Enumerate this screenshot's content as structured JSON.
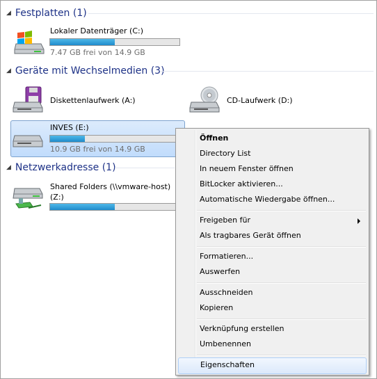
{
  "groups": [
    {
      "title": "Festplatten (1)"
    },
    {
      "title": "Geräte mit Wechselmedien (3)"
    },
    {
      "title": "Netzwerkadresse (1)"
    }
  ],
  "drives": {
    "local_c": {
      "name": "Lokaler Datenträger (C:)",
      "free": "7.47 GB frei von 14.9 GB",
      "used_fraction": 0.5,
      "icon": "hard-drive-windows-icon"
    },
    "floppy_a": {
      "name": "Diskettenlaufwerk (A:)",
      "icon": "floppy-drive-icon"
    },
    "cd_d": {
      "name": "CD-Laufwerk (D:)",
      "icon": "cd-drive-icon"
    },
    "usb_e": {
      "name": "INVES (E:)",
      "free": "10.9 GB frei von 14.9 GB",
      "used_fraction": 0.27,
      "icon": "removable-drive-icon"
    },
    "network_z": {
      "name_line1": "Shared Folders (\\\\vmware-host)",
      "name_line2": "(Z:)",
      "used_fraction": 0.5,
      "icon": "network-drive-icon"
    }
  },
  "context_menu": {
    "items": [
      {
        "label": "Öffnen",
        "bold": true
      },
      {
        "label": "Directory List"
      },
      {
        "label": "In neuem Fenster öffnen"
      },
      {
        "label": "BitLocker aktivieren..."
      },
      {
        "label": "Automatische Wiedergabe öffnen..."
      },
      {
        "label": "Freigeben für",
        "submenu": true
      },
      {
        "label": "Als tragbares Gerät öffnen"
      },
      {
        "label": "Formatieren..."
      },
      {
        "label": "Auswerfen"
      },
      {
        "label": "Ausschneiden"
      },
      {
        "label": "Kopieren"
      },
      {
        "label": "Verknüpfung erstellen"
      },
      {
        "label": "Umbenennen"
      },
      {
        "label": "Eigenschaften",
        "highlighted": true
      }
    ]
  }
}
